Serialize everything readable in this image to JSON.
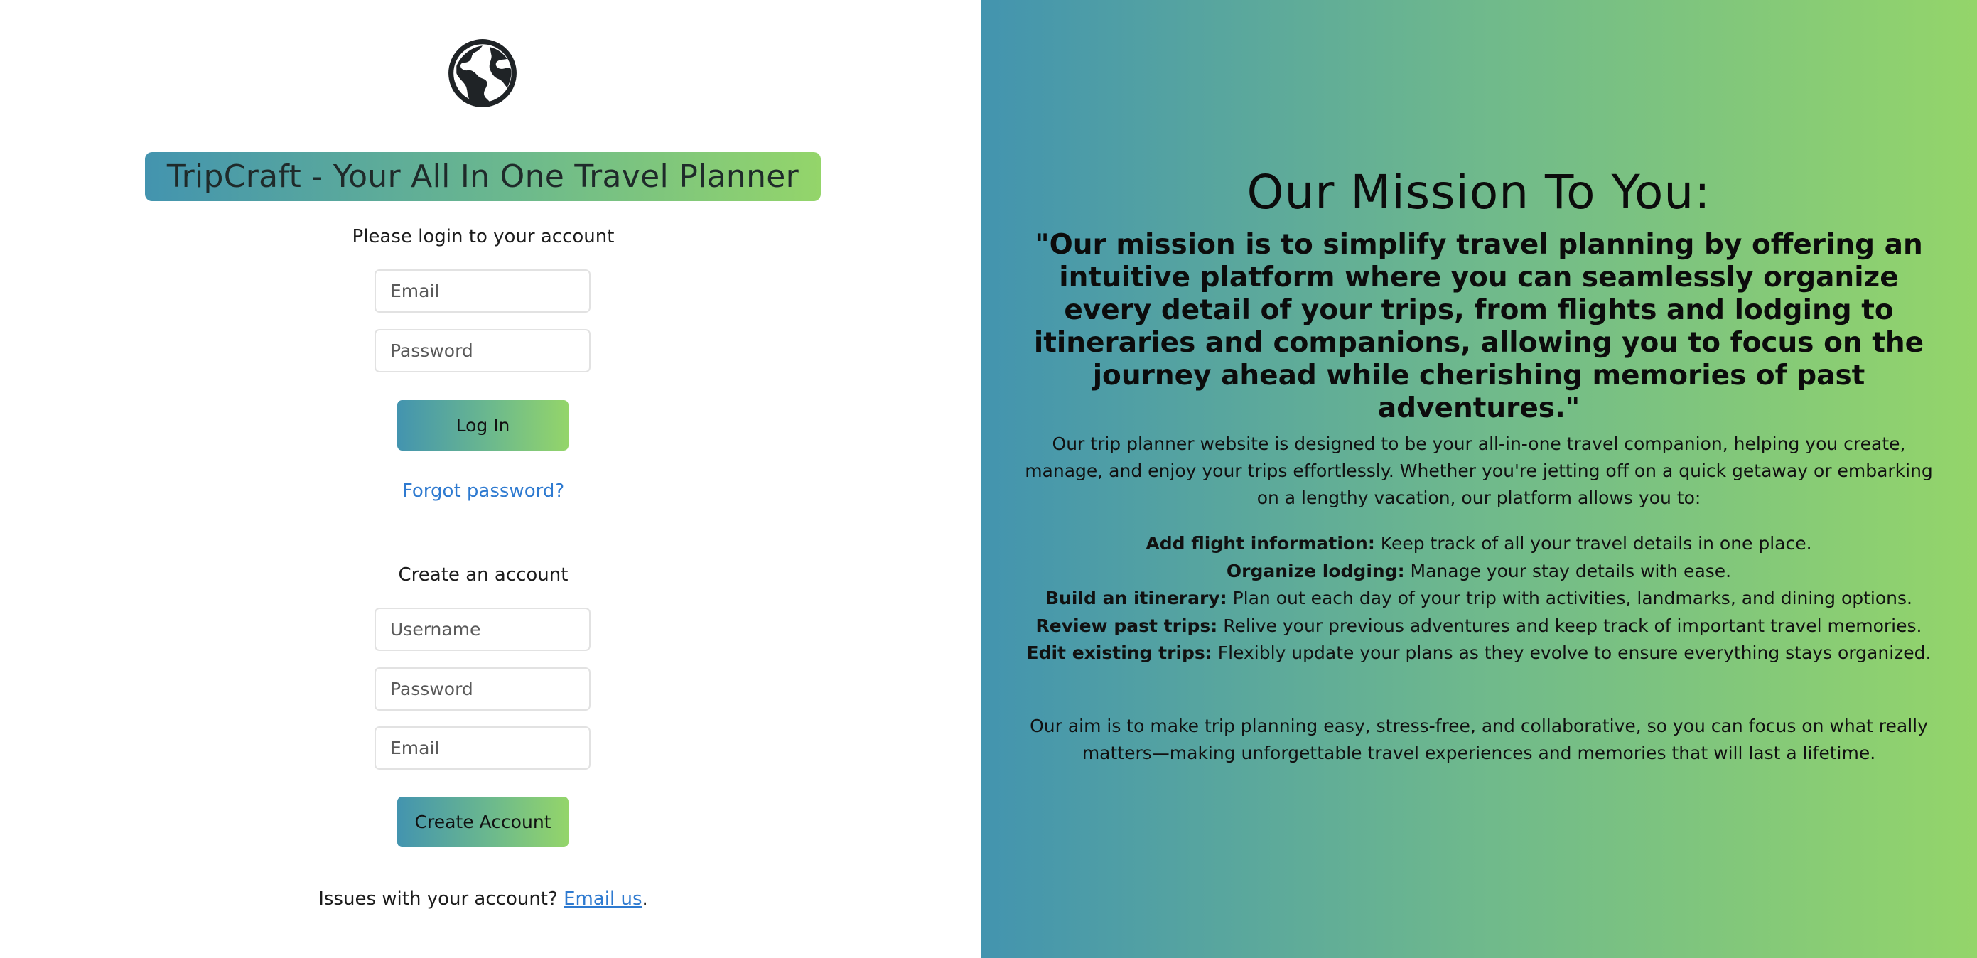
{
  "brand": {
    "title": "TripCraft - Your All In One Travel Planner",
    "logo_icon": "globe-americas-icon"
  },
  "login": {
    "prompt": "Please login to your account",
    "email_placeholder": "Email",
    "password_placeholder": "Password",
    "login_button": "Log In",
    "forgot_link": "Forgot password?"
  },
  "signup": {
    "heading": "Create an account",
    "username_placeholder": "Username",
    "password_placeholder": "Password",
    "email_placeholder": "Email",
    "create_button": "Create Account"
  },
  "support": {
    "text": "Issues with your account?",
    "link": "Email us",
    "suffix": "."
  },
  "mission": {
    "heading": "Our Mission To You:",
    "quote": "\"Our mission is to simplify travel planning by offering an intuitive platform where you can seamlessly organize every detail of your trips, from flights and lodging to itineraries and companions, allowing you to focus on the journey ahead while cherishing memories of past adventures.\"",
    "intro": "Our trip planner website is designed to be your all-in-one travel companion, helping you create, manage, and enjoy your trips effortlessly. Whether you're jetting off on a quick getaway or embarking on a lengthy vacation, our platform allows you to:",
    "features": [
      {
        "label": "Add flight information:",
        "text": " Keep track of all your travel details in one place."
      },
      {
        "label": "Organize lodging:",
        "text": " Manage your stay details with ease."
      },
      {
        "label": "Build an itinerary:",
        "text": " Plan out each day of your trip with activities, landmarks, and dining options."
      },
      {
        "label": "Review past trips:",
        "text": " Relive your previous adventures and keep track of important travel memories."
      },
      {
        "label": "Edit existing trips:",
        "text": " Flexibly update your plans as they evolve to ensure everything stays organized."
      }
    ],
    "aim": "Our aim is to make trip planning easy, stress-free, and collaborative, so you can focus on what really matters—making unforgettable travel experiences and memories that will last a lifetime."
  },
  "colors": {
    "gradient_start": "#4394af",
    "gradient_end": "#94d56a",
    "link": "#2e7ad0"
  }
}
